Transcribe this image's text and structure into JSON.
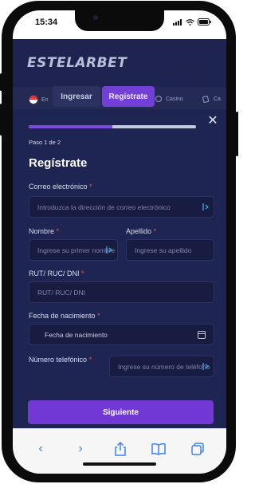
{
  "status_bar": {
    "time": "15:34"
  },
  "header": {
    "logo": "ESTELARBET",
    "login_label": "Ingresar",
    "register_label": "Regístrate",
    "categories": [
      {
        "label": "En",
        "icon": "chile-flag-icon"
      },
      {
        "label": "Casino",
        "icon": "casino-icon"
      },
      {
        "label": "Ca",
        "icon": "cards-icon"
      }
    ]
  },
  "modal": {
    "step_text": "Paso 1 de 2",
    "progress": 0.5,
    "title": "Regístrate",
    "fields": {
      "email": {
        "label": "Correo electrónico",
        "required": "*",
        "placeholder": "Introduzca la dirección de correo electrónico"
      },
      "first_name": {
        "label": "Nombre",
        "required": "*",
        "placeholder": "Ingrese su primer nombre"
      },
      "last_name": {
        "label": "Apellido",
        "required": "*",
        "placeholder": "Ingrese su apellido"
      },
      "rut": {
        "label": "RUT/ RUC/ DNI",
        "required": "*",
        "placeholder": "RUT/ RUC/ DNI"
      },
      "birth_date": {
        "label": "Fecha de nacimiento",
        "required": "*",
        "placeholder": "Fecha de nacimiento"
      },
      "phone": {
        "label": "Número telefónico",
        "required": "*",
        "placeholder": "Ingrese su número de teléfono"
      }
    },
    "submit_label": "Siguiente"
  },
  "browser_toolbar": {
    "buttons": [
      "back-icon",
      "forward-icon",
      "share-icon",
      "bookmarks-icon",
      "tabs-icon"
    ]
  },
  "colors": {
    "accent": "#7138d3",
    "modal_bg": "#1f2553",
    "field_bg": "#171c40",
    "required": "#e05a6a"
  }
}
